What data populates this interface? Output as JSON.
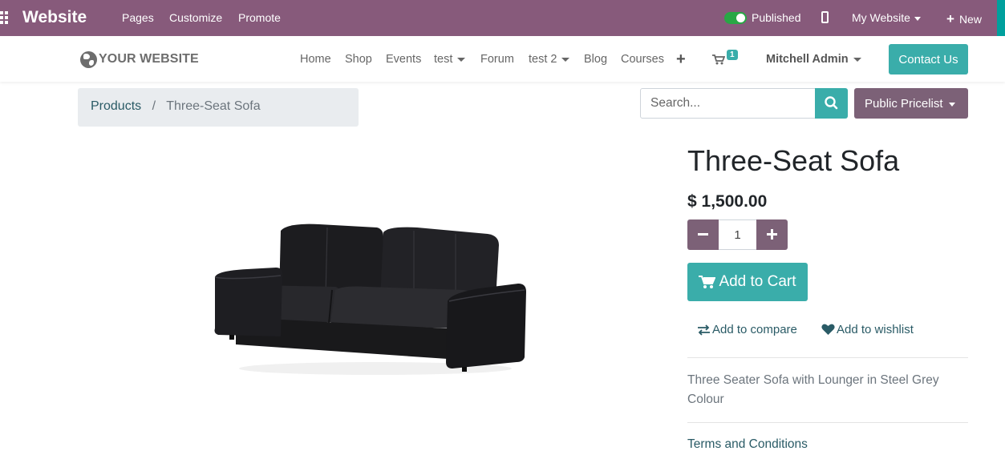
{
  "admin_bar": {
    "brand": "Website",
    "menu": [
      "Pages",
      "Customize",
      "Promote"
    ],
    "published_label": "Published",
    "website_menu": "My Website",
    "new_label": "New"
  },
  "navbar": {
    "logo_text": "YOUR WEBSITE",
    "items": [
      "Home",
      "Shop",
      "Events",
      "test",
      "Forum",
      "test 2",
      "Blog",
      "Courses"
    ],
    "cart_count": "1",
    "user": "Mitchell Admin",
    "contact": "Contact Us"
  },
  "breadcrumb": {
    "parent": "Products",
    "separator": "/",
    "current": "Three-Seat Sofa"
  },
  "search": {
    "placeholder": "Search..."
  },
  "pricelist": "Public Pricelist",
  "product": {
    "name": "Three-Seat Sofa",
    "price": "$ 1,500.00",
    "quantity": "1",
    "add_to_cart": "Add to Cart",
    "add_to_compare": "Add to compare",
    "add_to_wishlist": "Add to wishlist",
    "description": "Three Seater Sofa with Lounger in Steel Grey Colour",
    "terms": "Terms and Conditions"
  },
  "colors": {
    "admin_bar": "#875a7b",
    "primary_teal": "#3aadaa",
    "secondary_purple": "#7c6177",
    "link": "#2a5b66"
  },
  "icons": [
    "apps-grid-icon",
    "toggle-icon",
    "mobile-icon",
    "plus-icon",
    "globe-icon",
    "cart-icon",
    "search-icon",
    "minus-icon",
    "compare-icon",
    "heart-icon"
  ]
}
